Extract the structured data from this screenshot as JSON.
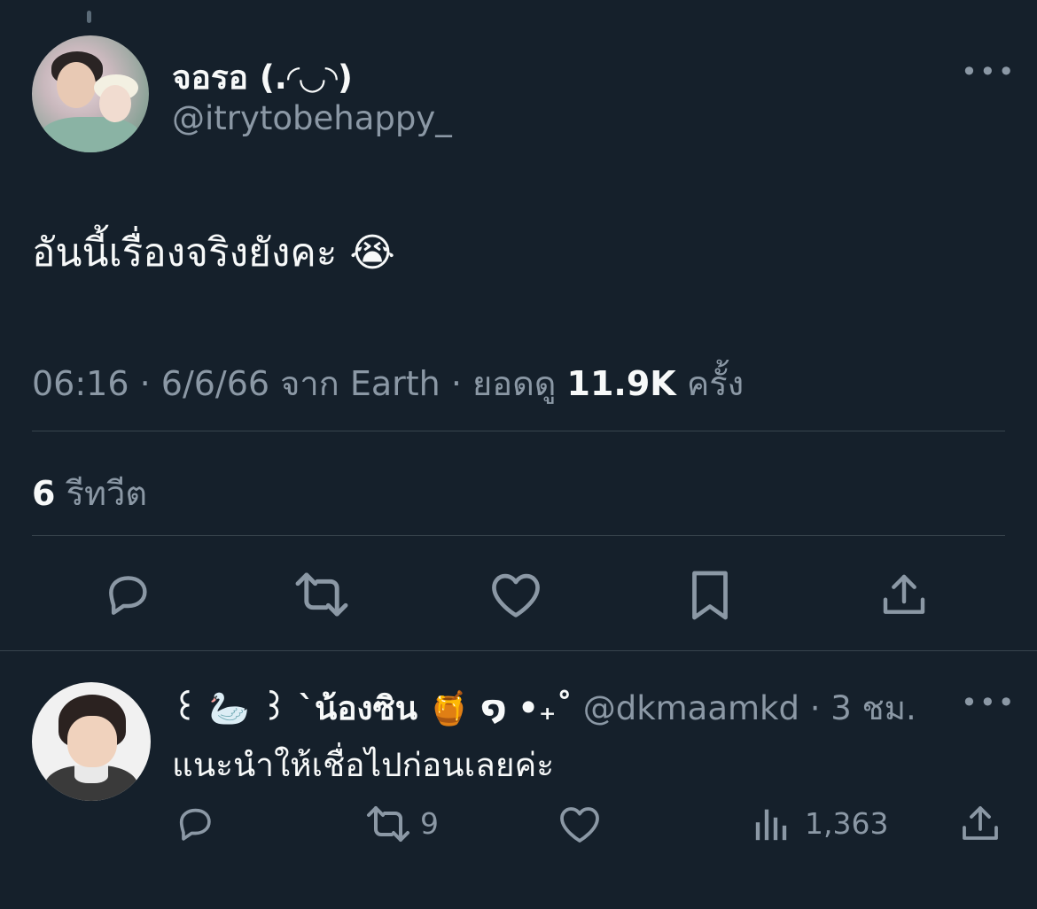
{
  "tweet": {
    "author": {
      "display_name": "จอรอ (.◜◡◝)",
      "handle": "@itrytobehappy_"
    },
    "text": "อันนี้เรื่องจริงยังคะ 😭",
    "meta": {
      "time": "06:16",
      "sep1": " · ",
      "date": "6/6/66",
      "source": " จาก Earth",
      "sep2": " · ",
      "views_label": "ยอดดู ",
      "views": "11.9K",
      "views_suffix": " ครั้ง"
    },
    "retweets": {
      "count": "6",
      "label": " รีทวีต"
    },
    "actions": [
      "reply-icon",
      "retweet-icon",
      "like-icon",
      "bookmark-icon",
      "share-icon"
    ]
  },
  "reply": {
    "display_name": "꒰ 🦢 ꒱ `น้องซิน 🍯 ໑ •₊˚",
    "handle_time": " @dkmaamkd · 3 ชม.",
    "text": "แนะนำให้เชื่อไปก่อนเลยค่ะ",
    "retweet_count": "9",
    "views": "1,363"
  },
  "colors": {
    "background": "#15202b",
    "primary_text": "#f7f9f9",
    "secondary_text": "#8b98a5",
    "divider": "#38444d"
  }
}
